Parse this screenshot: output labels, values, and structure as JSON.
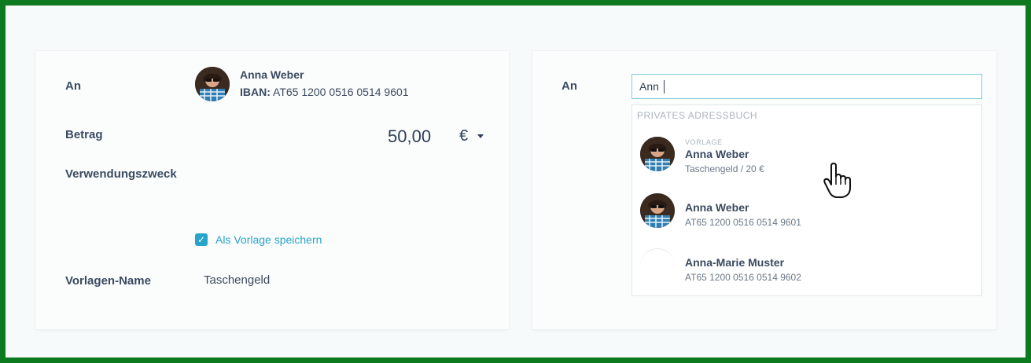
{
  "form": {
    "to_label": "An",
    "recipient": {
      "name": "Anna Weber",
      "iban_label": "IBAN:",
      "iban": "AT65 1200 0516 0514 9601"
    },
    "amount_label": "Betrag",
    "amount_value": "50,00",
    "currency": "€",
    "purpose_label": "Verwendungszweck",
    "save_template_checked": true,
    "save_template_label": "Als Vorlage speichern",
    "template_name_label": "Vorlagen-Name",
    "template_name_value": "Taschengeld"
  },
  "search": {
    "to_label": "An",
    "query": "Ann",
    "dropdown_header": "PRIVATES ADRESSBUCH",
    "results": [
      {
        "tag": "VORLAGE",
        "name": "Anna Weber",
        "detail": "Taschengeld / 20 €"
      },
      {
        "tag": "",
        "name": "Anna Weber",
        "detail": "AT65 1200 0516 0514 9601"
      },
      {
        "tag": "",
        "name": "Anna-Marie Muster",
        "detail": "AT65 1200 0516 0514 9602"
      }
    ]
  },
  "colors": {
    "accent": "#27a4c9",
    "frame": "#0d7a1f",
    "text": "#2e3f55"
  },
  "icons": {
    "checkbox": "check-icon",
    "currency_dropdown": "caret-down-icon",
    "pointer": "hand-pointer-icon"
  }
}
